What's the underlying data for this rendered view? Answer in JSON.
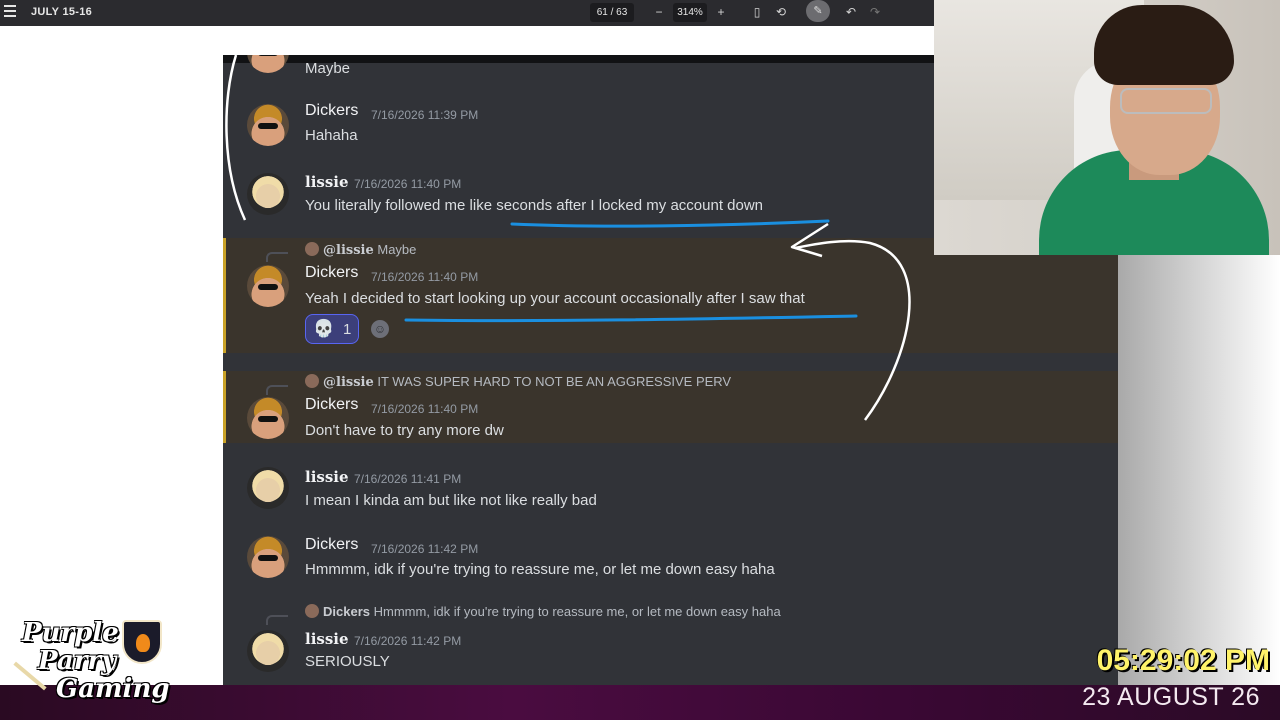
{
  "toolbar": {
    "doc_title": "JULY 15-16",
    "page": "61 / 63",
    "zoom": "314%",
    "minus": "−",
    "plus": "+"
  },
  "chat": {
    "top_partial": {
      "body": "Maybe"
    },
    "messages": [
      {
        "user": "Dickers",
        "time": "7/16/2026 11:39 PM",
        "body": "Hahaha"
      },
      {
        "user": "lissie",
        "time": "7/16/2026 11:40 PM",
        "body": "You literally followed me like seconds after I locked my account down"
      },
      {
        "reply_user": "@lissie",
        "reply_text": "Maybe",
        "user": "Dickers",
        "time": "7/16/2026 11:40 PM",
        "body": "Yeah I decided to start looking up your account occasionally after I saw that",
        "reaction_count": "1"
      },
      {
        "reply_user": "@lissie",
        "reply_text": "IT WAS SUPER HARD TO NOT BE AN AGGRESSIVE PERV",
        "user": "Dickers",
        "time": "7/16/2026 11:40 PM",
        "body": "Don't have to try any more dw"
      },
      {
        "user": "lissie",
        "time": "7/16/2026 11:41 PM",
        "body": "I mean I kinda am but like not like really bad"
      },
      {
        "user": "Dickers",
        "time": "7/16/2026 11:42 PM",
        "body": "Hmmmm, idk if you're trying to reassure me, or let me down easy haha"
      },
      {
        "reply_user": "Dickers",
        "reply_text": "Hmmmm, idk if you're trying to reassure me, or let me down easy haha",
        "user": "lissie",
        "time": "7/16/2026 11:42 PM",
        "body": "SERIOUSLY"
      }
    ]
  },
  "overlay": {
    "clock": "05:29:02 PM",
    "date": "23 AUGUST 26",
    "logo_line1": "Purple",
    "logo_line2": "Parry",
    "logo_line3": "Gaming"
  },
  "colors": {
    "underline": "#1a8fe0",
    "highlight_bar": "#c9a227",
    "clock": "#fff36a"
  }
}
